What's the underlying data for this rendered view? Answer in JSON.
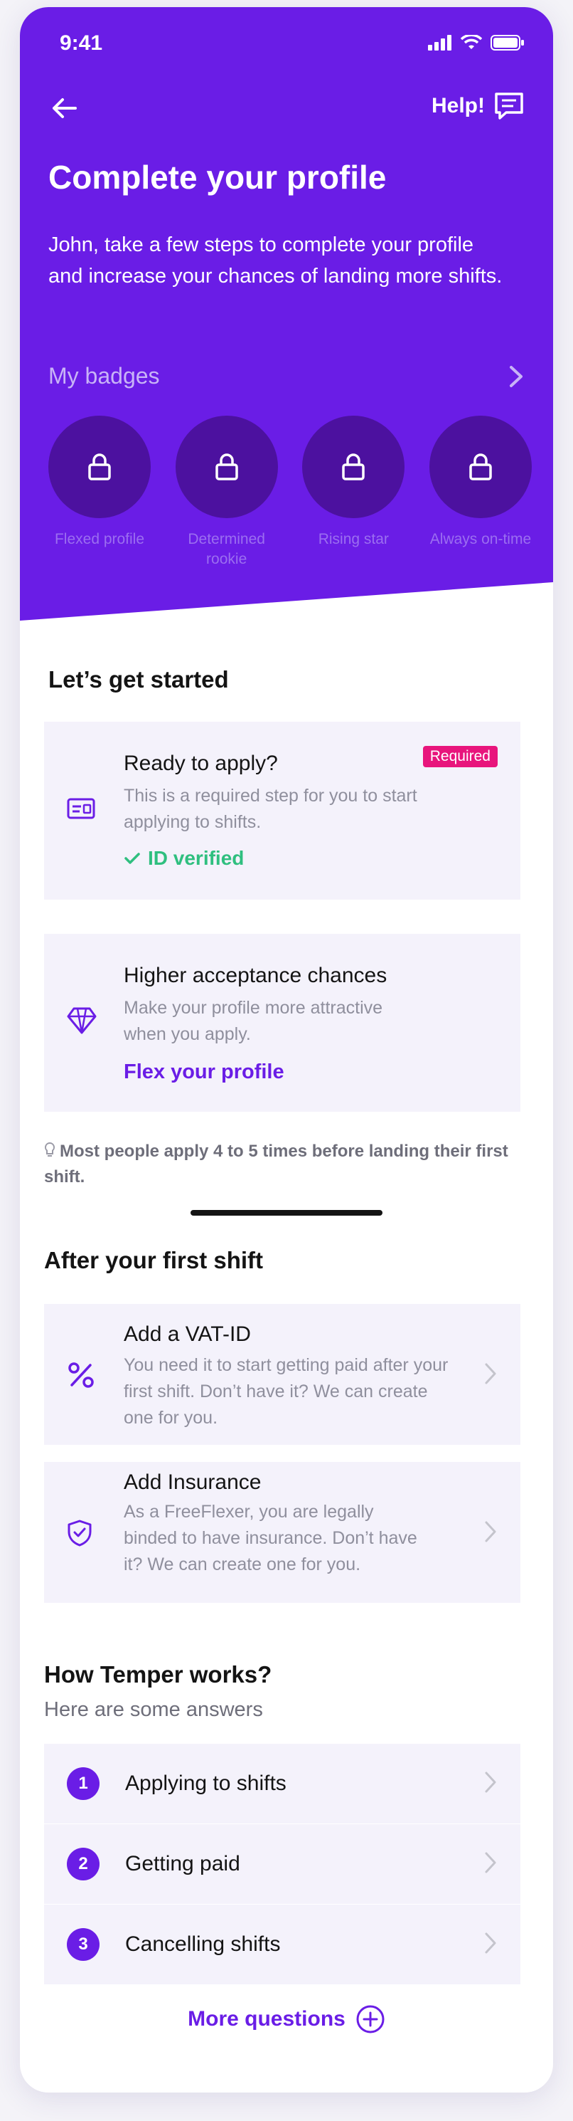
{
  "status_bar": {
    "time": "9:41"
  },
  "header": {
    "help_label": "Help!",
    "title": "Complete your profile",
    "subtitle": "John, take a few steps to complete your profile and increase your chances of landing more shifts."
  },
  "badges": {
    "title": "My badges",
    "items": [
      {
        "label": "Flexed profile"
      },
      {
        "label": "Determined rookie"
      },
      {
        "label": "Rising star"
      },
      {
        "label": "Always on-time"
      }
    ]
  },
  "get_started": {
    "title": "Let’s get started",
    "ready_card": {
      "title": "Ready to apply?",
      "tag": "Required",
      "description": "This is a required step for you to start applying to shifts.",
      "status": "ID verified"
    },
    "acceptance_card": {
      "title": "Higher acceptance chances",
      "description": "Make your profile more attractive when you apply.",
      "link": "Flex your profile"
    },
    "tip": "Most people apply 4 to 5 times before landing their first shift."
  },
  "after_first_shift": {
    "title": "After your first shift",
    "vat_card": {
      "title": "Add a VAT-ID",
      "description": "You need it to start getting paid after your first shift. Don’t have it? We can create one for you."
    },
    "insurance_card": {
      "title": "Add Insurance",
      "description": "As a FreeFlexer, you are legally binded to have insurance. Don’t have it? We can create one for you."
    }
  },
  "faq": {
    "title": "How Temper works?",
    "subtitle": "Here are some answers",
    "items": [
      {
        "num": "1",
        "label": "Applying to shifts"
      },
      {
        "num": "2",
        "label": "Getting paid"
      },
      {
        "num": "3",
        "label": "Cancelling shifts"
      }
    ],
    "more_label": "More questions"
  },
  "colors": {
    "brand": "#6a1de6",
    "required": "#e8157c",
    "success": "#2fbf7f"
  }
}
